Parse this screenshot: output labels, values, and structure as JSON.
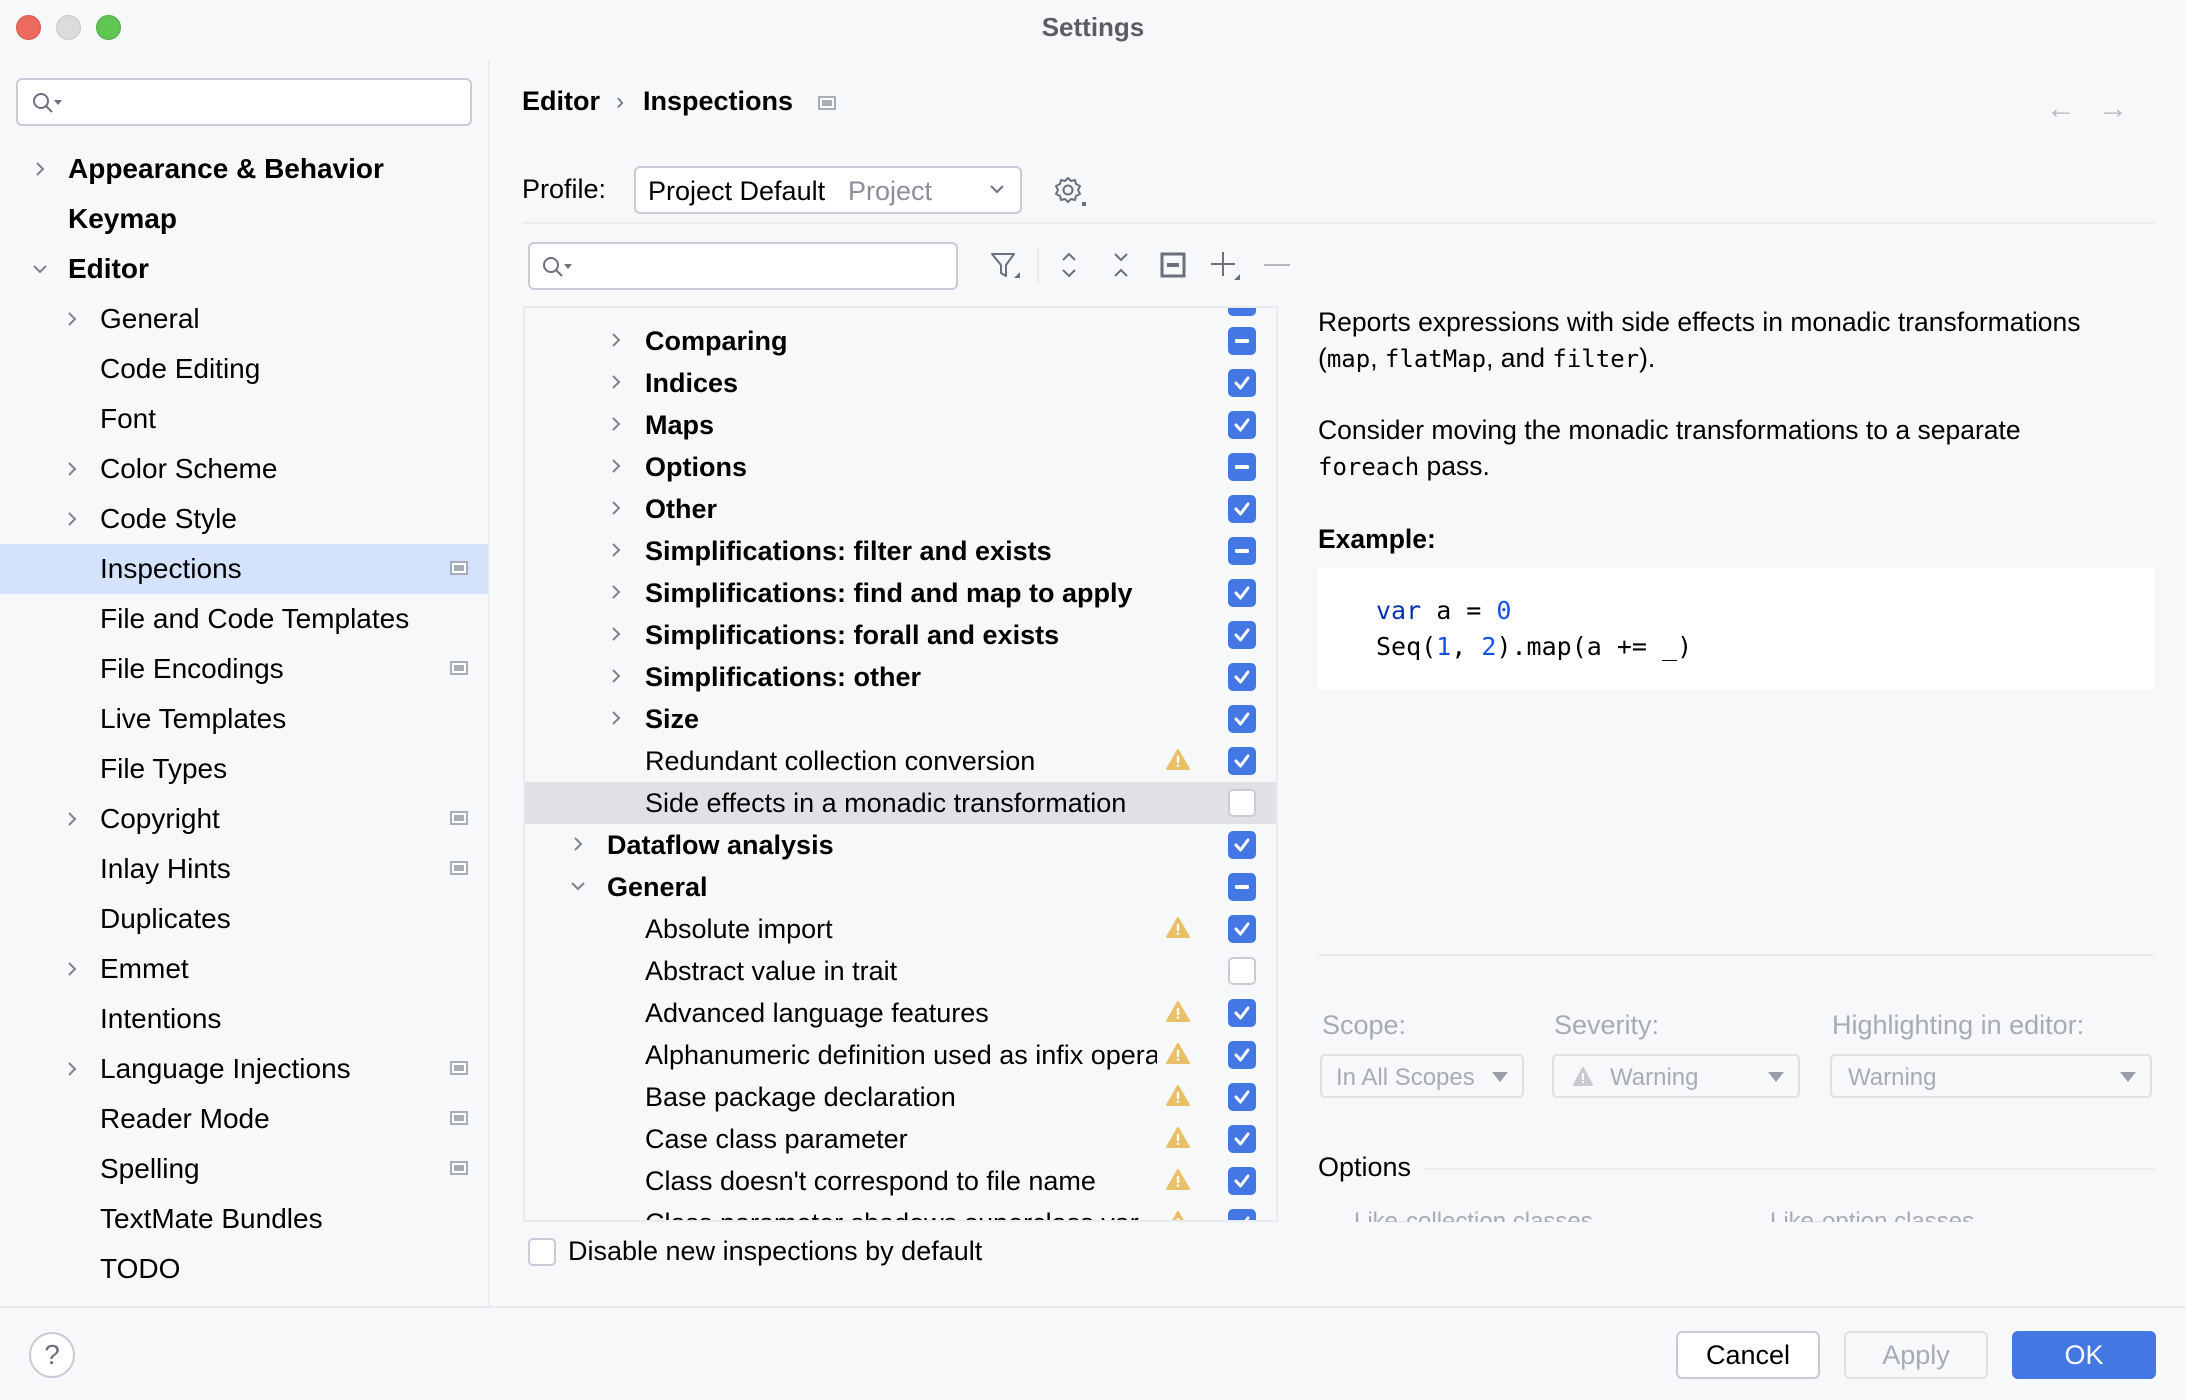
{
  "window": {
    "title": "Settings"
  },
  "sidebar": {
    "search_placeholder": "",
    "items": [
      {
        "label": "Appearance & Behavior",
        "level": 0,
        "expandable": true,
        "expanded": false,
        "bold": true,
        "project_icon": false,
        "selected": false
      },
      {
        "label": "Keymap",
        "level": 0,
        "expandable": false,
        "expanded": false,
        "bold": true,
        "project_icon": false,
        "selected": false
      },
      {
        "label": "Editor",
        "level": 0,
        "expandable": true,
        "expanded": true,
        "bold": true,
        "project_icon": false,
        "selected": false
      },
      {
        "label": "General",
        "level": 1,
        "expandable": true,
        "expanded": false,
        "bold": false,
        "project_icon": false,
        "selected": false
      },
      {
        "label": "Code Editing",
        "level": 1,
        "expandable": false,
        "expanded": false,
        "bold": false,
        "project_icon": false,
        "selected": false
      },
      {
        "label": "Font",
        "level": 1,
        "expandable": false,
        "expanded": false,
        "bold": false,
        "project_icon": false,
        "selected": false
      },
      {
        "label": "Color Scheme",
        "level": 1,
        "expandable": true,
        "expanded": false,
        "bold": false,
        "project_icon": false,
        "selected": false
      },
      {
        "label": "Code Style",
        "level": 1,
        "expandable": true,
        "expanded": false,
        "bold": false,
        "project_icon": false,
        "selected": false
      },
      {
        "label": "Inspections",
        "level": 1,
        "expandable": false,
        "expanded": false,
        "bold": false,
        "project_icon": true,
        "selected": true
      },
      {
        "label": "File and Code Templates",
        "level": 1,
        "expandable": false,
        "expanded": false,
        "bold": false,
        "project_icon": false,
        "selected": false
      },
      {
        "label": "File Encodings",
        "level": 1,
        "expandable": false,
        "expanded": false,
        "bold": false,
        "project_icon": true,
        "selected": false
      },
      {
        "label": "Live Templates",
        "level": 1,
        "expandable": false,
        "expanded": false,
        "bold": false,
        "project_icon": false,
        "selected": false
      },
      {
        "label": "File Types",
        "level": 1,
        "expandable": false,
        "expanded": false,
        "bold": false,
        "project_icon": false,
        "selected": false
      },
      {
        "label": "Copyright",
        "level": 1,
        "expandable": true,
        "expanded": false,
        "bold": false,
        "project_icon": true,
        "selected": false
      },
      {
        "label": "Inlay Hints",
        "level": 1,
        "expandable": false,
        "expanded": false,
        "bold": false,
        "project_icon": true,
        "selected": false
      },
      {
        "label": "Duplicates",
        "level": 1,
        "expandable": false,
        "expanded": false,
        "bold": false,
        "project_icon": false,
        "selected": false
      },
      {
        "label": "Emmet",
        "level": 1,
        "expandable": true,
        "expanded": false,
        "bold": false,
        "project_icon": false,
        "selected": false
      },
      {
        "label": "Intentions",
        "level": 1,
        "expandable": false,
        "expanded": false,
        "bold": false,
        "project_icon": false,
        "selected": false
      },
      {
        "label": "Language Injections",
        "level": 1,
        "expandable": true,
        "expanded": false,
        "bold": false,
        "project_icon": true,
        "selected": false
      },
      {
        "label": "Reader Mode",
        "level": 1,
        "expandable": false,
        "expanded": false,
        "bold": false,
        "project_icon": true,
        "selected": false
      },
      {
        "label": "Spelling",
        "level": 1,
        "expandable": false,
        "expanded": false,
        "bold": false,
        "project_icon": true,
        "selected": false
      },
      {
        "label": "TextMate Bundles",
        "level": 1,
        "expandable": false,
        "expanded": false,
        "bold": false,
        "project_icon": false,
        "selected": false
      },
      {
        "label": "TODO",
        "level": 1,
        "expandable": false,
        "expanded": false,
        "bold": false,
        "project_icon": false,
        "selected": false
      }
    ]
  },
  "header": {
    "breadcrumb": [
      "Editor",
      "Inspections"
    ],
    "separator": "›",
    "back_icon": "←",
    "forward_icon": "→"
  },
  "profile": {
    "label": "Profile:",
    "value": "Project Default",
    "value_sub": "Project"
  },
  "toolbar": {
    "search_placeholder": "",
    "icons": [
      "filter-icon",
      "expand-all-icon",
      "collapse-all-icon",
      "reset-to-default-icon",
      "add-icon",
      "remove-icon"
    ]
  },
  "inspections": [
    {
      "label": "Comparing",
      "level": 1,
      "group": true,
      "expanded": false,
      "state": "partial",
      "warning": false,
      "selected": false
    },
    {
      "label": "Indices",
      "level": 1,
      "group": true,
      "expanded": false,
      "state": "checked",
      "warning": false,
      "selected": false
    },
    {
      "label": "Maps",
      "level": 1,
      "group": true,
      "expanded": false,
      "state": "checked",
      "warning": false,
      "selected": false
    },
    {
      "label": "Options",
      "level": 1,
      "group": true,
      "expanded": false,
      "state": "partial",
      "warning": false,
      "selected": false
    },
    {
      "label": "Other",
      "level": 1,
      "group": true,
      "expanded": false,
      "state": "checked",
      "warning": false,
      "selected": false
    },
    {
      "label": "Simplifications: filter and exists",
      "level": 1,
      "group": true,
      "expanded": false,
      "state": "partial",
      "warning": false,
      "selected": false
    },
    {
      "label": "Simplifications: find and map to apply",
      "level": 1,
      "group": true,
      "expanded": false,
      "state": "checked",
      "warning": false,
      "selected": false
    },
    {
      "label": "Simplifications: forall and exists",
      "level": 1,
      "group": true,
      "expanded": false,
      "state": "checked",
      "warning": false,
      "selected": false
    },
    {
      "label": "Simplifications: other",
      "level": 1,
      "group": true,
      "expanded": false,
      "state": "checked",
      "warning": false,
      "selected": false
    },
    {
      "label": "Size",
      "level": 1,
      "group": true,
      "expanded": false,
      "state": "checked",
      "warning": false,
      "selected": false
    },
    {
      "label": "Redundant collection conversion",
      "level": 2,
      "group": false,
      "expanded": false,
      "state": "checked",
      "warning": true,
      "selected": false
    },
    {
      "label": "Side effects in a monadic transformation",
      "level": 2,
      "group": false,
      "expanded": false,
      "state": "unchecked",
      "warning": false,
      "selected": true
    },
    {
      "label": "Dataflow analysis",
      "level": 0,
      "group": true,
      "expanded": false,
      "state": "checked",
      "warning": false,
      "selected": false
    },
    {
      "label": "General",
      "level": 0,
      "group": true,
      "expanded": true,
      "state": "partial",
      "warning": false,
      "selected": false
    },
    {
      "label": "Absolute import",
      "level": 2,
      "group": false,
      "expanded": false,
      "state": "checked",
      "warning": true,
      "selected": false
    },
    {
      "label": "Abstract value in trait",
      "level": 2,
      "group": false,
      "expanded": false,
      "state": "unchecked",
      "warning": false,
      "selected": false
    },
    {
      "label": "Advanced language features",
      "level": 2,
      "group": false,
      "expanded": false,
      "state": "checked",
      "warning": true,
      "selected": false
    },
    {
      "label": "Alphanumeric definition used as infix operator",
      "level": 2,
      "group": false,
      "expanded": false,
      "state": "checked",
      "warning": true,
      "selected": false
    },
    {
      "label": "Base package declaration",
      "level": 2,
      "group": false,
      "expanded": false,
      "state": "checked",
      "warning": true,
      "selected": false
    },
    {
      "label": "Case class parameter",
      "level": 2,
      "group": false,
      "expanded": false,
      "state": "checked",
      "warning": true,
      "selected": false
    },
    {
      "label": "Class doesn't correspond to file name",
      "level": 2,
      "group": false,
      "expanded": false,
      "state": "checked",
      "warning": true,
      "selected": false
    },
    {
      "label": "Class parameter shadows superclass var",
      "level": 2,
      "group": false,
      "expanded": false,
      "state": "checked",
      "warning": true,
      "selected": false
    }
  ],
  "disable_new": {
    "label": "Disable new inspections by default",
    "checked": false
  },
  "description": {
    "p1_text_a": "Reports expressions with side effects in monadic transformations",
    "p1_paren_open": "(",
    "p1_code1": "map",
    "p1_sep1": ", ",
    "p1_code2": "flatMap",
    "p1_sep2": ", and ",
    "p1_code3": "filter",
    "p1_end": ").",
    "p2_text": "Consider moving the monadic transformations to a separate",
    "p2_code": "foreach",
    "p2_end": " pass.",
    "example_title": "Example:",
    "code": {
      "line1_kw": "var",
      "line1_mid": " a = ",
      "line1_num": "0",
      "line2_a": "Seq(",
      "line2_n1": "1",
      "line2_b": ", ",
      "line2_n2": "2",
      "line2_c": ").map(a += _)"
    }
  },
  "settings_fields": {
    "scope_label": "Scope:",
    "scope_value": "In All Scopes",
    "severity_label": "Severity:",
    "severity_value": "Warning",
    "highlighting_label": "Highlighting in editor:",
    "highlighting_value": "Warning"
  },
  "options": {
    "title": "Options",
    "items": [
      "Like-collection classes",
      "Like-option classes"
    ]
  },
  "footer": {
    "help": "?",
    "cancel": "Cancel",
    "apply": "Apply",
    "ok": "OK"
  },
  "colors": {
    "accent": "#4277e4",
    "selection": "#d4e2fb",
    "warning": "#e9bf67"
  }
}
